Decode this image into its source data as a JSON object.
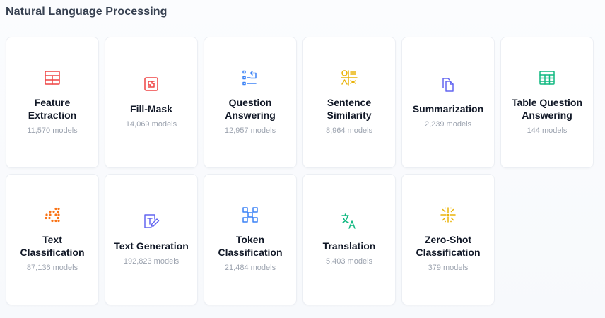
{
  "section": {
    "title": "Natural Language Processing"
  },
  "cards": [
    {
      "name": "Feature Extraction",
      "count": "11,570 models",
      "icon": "feature-extraction-icon",
      "color": "#ef4444"
    },
    {
      "name": "Fill-Mask",
      "count": "14,069 models",
      "icon": "fill-mask-icon",
      "color": "#ef4444"
    },
    {
      "name": "Question Answering",
      "count": "12,957 models",
      "icon": "question-answering-icon",
      "color": "#3b82f6"
    },
    {
      "name": "Sentence Similarity",
      "count": "8,964 models",
      "icon": "sentence-similarity-icon",
      "color": "#eab308"
    },
    {
      "name": "Summarization",
      "count": "2,239 models",
      "icon": "summarization-icon",
      "color": "#6366f1"
    },
    {
      "name": "Table Question Answering",
      "count": "144 models",
      "icon": "table-question-answering-icon",
      "color": "#10b981"
    },
    {
      "name": "Text Classification",
      "count": "87,136 models",
      "icon": "text-classification-icon",
      "color": "#f97316"
    },
    {
      "name": "Text Generation",
      "count": "192,823 models",
      "icon": "text-generation-icon",
      "color": "#6366f1"
    },
    {
      "name": "Token Classification",
      "count": "21,484 models",
      "icon": "token-classification-icon",
      "color": "#3b82f6"
    },
    {
      "name": "Translation",
      "count": "5,403 models",
      "icon": "translation-icon",
      "color": "#10b981"
    },
    {
      "name": "Zero-Shot Classification",
      "count": "379 models",
      "icon": "zero-shot-classification-icon",
      "color": "#eab308"
    }
  ]
}
